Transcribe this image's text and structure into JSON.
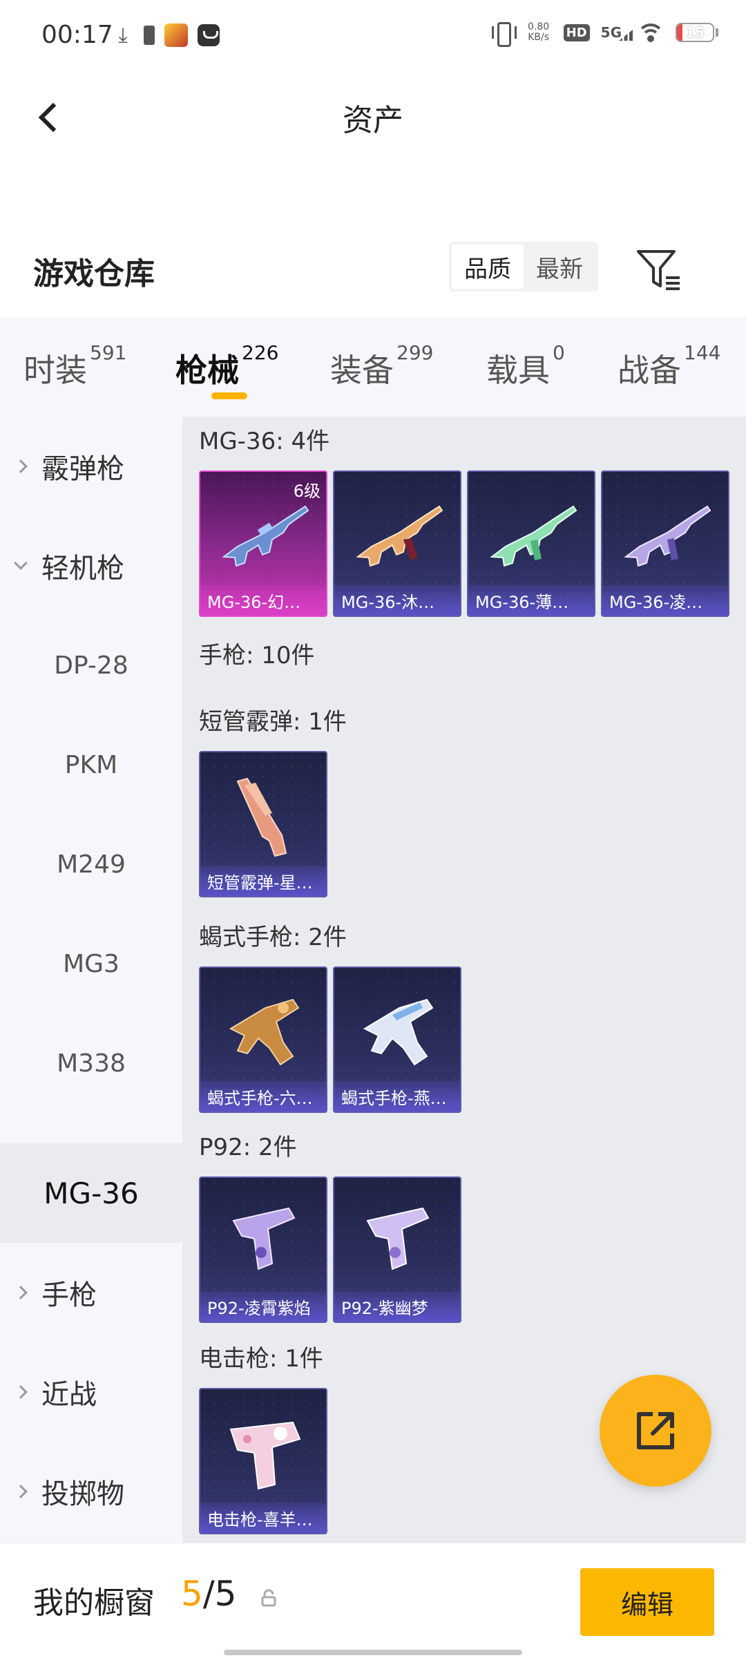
{
  "status_bar": {
    "time": "00:17",
    "net_speed_value": "0.80",
    "net_speed_unit": "KB/s",
    "hd_badge": "HD",
    "network_type": "5G",
    "battery": "15"
  },
  "nav": {
    "title": "资产"
  },
  "warehouse": {
    "title": "游戏仓库",
    "sort_options": [
      "品质",
      "最新"
    ],
    "sort_selected": "品质"
  },
  "tabs": [
    {
      "label": "时装",
      "count": "591"
    },
    {
      "label": "枪械",
      "count": "226",
      "active": true
    },
    {
      "label": "装备",
      "count": "299"
    },
    {
      "label": "载具",
      "count": "0"
    },
    {
      "label": "战备",
      "count": "144"
    }
  ],
  "sidebar": {
    "items": [
      {
        "label": "霰弹枪",
        "type": "collapsed"
      },
      {
        "label": "轻机枪",
        "type": "expanded"
      },
      {
        "label": "DP-28",
        "type": "sub"
      },
      {
        "label": "PKM",
        "type": "sub"
      },
      {
        "label": "M249",
        "type": "sub"
      },
      {
        "label": "MG3",
        "type": "sub"
      },
      {
        "label": "M338",
        "type": "sub"
      },
      {
        "label": "MG-36",
        "type": "selected"
      },
      {
        "label": "手枪",
        "type": "collapsed"
      },
      {
        "label": "近战",
        "type": "collapsed"
      },
      {
        "label": "投掷物",
        "type": "collapsed"
      }
    ]
  },
  "groups": [
    {
      "title": "MG-36: 4件",
      "items": [
        {
          "label": "MG-36-幻…",
          "level": "6级",
          "style": "pink",
          "icon": "rifle-icon"
        },
        {
          "label": "MG-36-沐…",
          "style": "normal",
          "icon": "rifle-icon"
        },
        {
          "label": "MG-36-薄…",
          "style": "normal",
          "icon": "rifle-icon"
        },
        {
          "label": "MG-36-凌…",
          "style": "normal",
          "icon": "rifle-icon"
        }
      ]
    },
    {
      "title": "手枪: 10件",
      "items": []
    },
    {
      "title": "短管霰弹: 1件",
      "items": [
        {
          "label": "短管霰弹-星…",
          "style": "normal",
          "icon": "sawed-off-icon"
        }
      ]
    },
    {
      "title": "蝎式手枪: 2件",
      "items": [
        {
          "label": "蝎式手枪-六…",
          "style": "normal",
          "icon": "smg-icon"
        },
        {
          "label": "蝎式手枪-燕…",
          "style": "normal",
          "icon": "smg-icon"
        }
      ]
    },
    {
      "title": "P92: 2件",
      "items": [
        {
          "label": "P92-凌霄紫焰",
          "style": "normal",
          "icon": "pistol-icon"
        },
        {
          "label": "P92-紫幽梦",
          "style": "normal",
          "icon": "pistol-icon"
        }
      ]
    },
    {
      "title": "电击枪: 1件",
      "items": [
        {
          "label": "电击枪-喜羊…",
          "style": "normal",
          "icon": "taser-icon"
        }
      ]
    }
  ],
  "bottom": {
    "showcase_label": "我的橱窗",
    "showcase_current": "5",
    "showcase_sep": "/",
    "showcase_total": "5",
    "edit_label": "编辑"
  },
  "colors": {
    "accent": "#fcb800",
    "tab_indicator": "#ffb300",
    "card_border": "#5d5aa8",
    "highlight_card": "#e34ad1"
  }
}
